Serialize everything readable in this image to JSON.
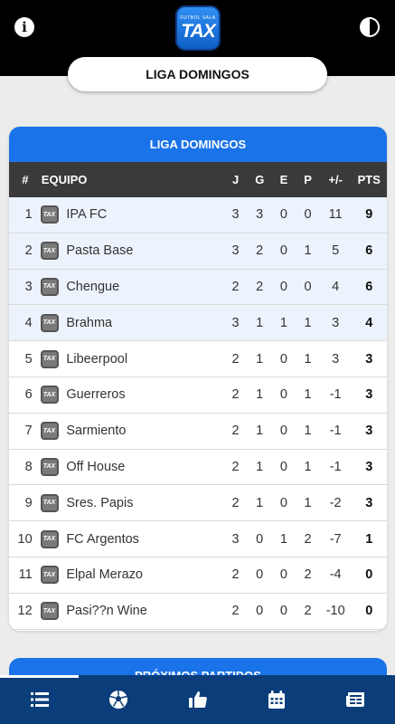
{
  "header": {
    "logo_small": "FUTBOL SALA",
    "logo_text": "TAX",
    "title": "LIGA DOMINGOS"
  },
  "standings": {
    "title": "LIGA DOMINGOS",
    "columns": {
      "pos": "#",
      "team": "EQUIPO",
      "j": "J",
      "g": "G",
      "e": "E",
      "p": "P",
      "dif": "+/-",
      "pts": "PTS"
    },
    "rows": [
      {
        "pos": "1",
        "team": "IPA FC",
        "j": "3",
        "g": "3",
        "e": "0",
        "p": "0",
        "dif": "11",
        "pts": "9"
      },
      {
        "pos": "2",
        "team": "Pasta Base",
        "j": "3",
        "g": "2",
        "e": "0",
        "p": "1",
        "dif": "5",
        "pts": "6"
      },
      {
        "pos": "3",
        "team": "Chengue",
        "j": "2",
        "g": "2",
        "e": "0",
        "p": "0",
        "dif": "4",
        "pts": "6"
      },
      {
        "pos": "4",
        "team": "Brahma",
        "j": "3",
        "g": "1",
        "e": "1",
        "p": "1",
        "dif": "3",
        "pts": "4"
      },
      {
        "pos": "5",
        "team": "Libeerpool",
        "j": "2",
        "g": "1",
        "e": "0",
        "p": "1",
        "dif": "3",
        "pts": "3"
      },
      {
        "pos": "6",
        "team": "Guerreros",
        "j": "2",
        "g": "1",
        "e": "0",
        "p": "1",
        "dif": "-1",
        "pts": "3"
      },
      {
        "pos": "7",
        "team": "Sarmiento",
        "j": "2",
        "g": "1",
        "e": "0",
        "p": "1",
        "dif": "-1",
        "pts": "3"
      },
      {
        "pos": "8",
        "team": "Off House",
        "j": "2",
        "g": "1",
        "e": "0",
        "p": "1",
        "dif": "-1",
        "pts": "3"
      },
      {
        "pos": "9",
        "team": "Sres. Papis",
        "j": "2",
        "g": "1",
        "e": "0",
        "p": "1",
        "dif": "-2",
        "pts": "3"
      },
      {
        "pos": "10",
        "team": "FC Argentos",
        "j": "3",
        "g": "0",
        "e": "1",
        "p": "2",
        "dif": "-7",
        "pts": "1"
      },
      {
        "pos": "11",
        "team": "Elpal Merazo",
        "j": "2",
        "g": "0",
        "e": "0",
        "p": "2",
        "dif": "-4",
        "pts": "0"
      },
      {
        "pos": "12",
        "team": "Pasi??n Wine",
        "j": "2",
        "g": "0",
        "e": "0",
        "p": "2",
        "dif": "-10",
        "pts": "0"
      }
    ]
  },
  "next_matches": {
    "title": "PRÓXIMOS PARTIDOS"
  },
  "nav": {
    "items": [
      {
        "icon": "standings-list-icon",
        "active": true
      },
      {
        "icon": "soccer-ball-icon",
        "active": false
      },
      {
        "icon": "thumbs-up-icon",
        "active": false
      },
      {
        "icon": "calendar-icon",
        "active": false
      },
      {
        "icon": "news-icon",
        "active": false
      }
    ]
  },
  "colors": {
    "accent": "#1a73e8",
    "nav_bg": "#0a3d7a",
    "table_header": "#3a3a3a",
    "highlight_row": "#edf3fc"
  }
}
